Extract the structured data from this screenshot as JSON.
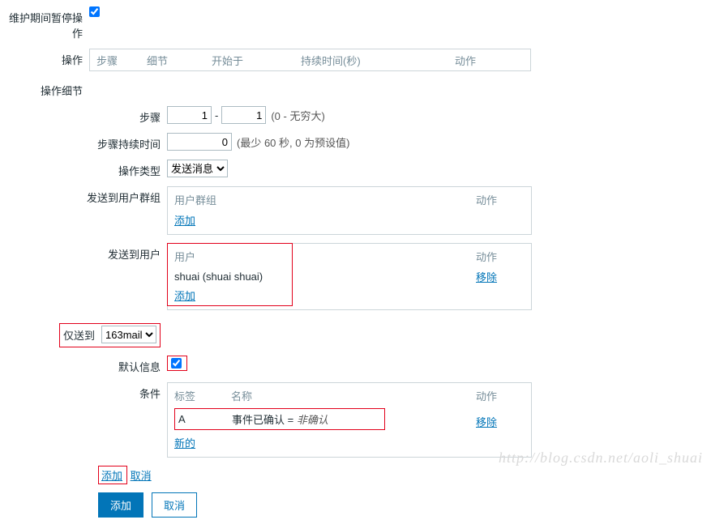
{
  "pause": {
    "label": "维护期间暂停操作",
    "checked": true
  },
  "ops": {
    "label": "操作",
    "tabs": {
      "steps": "步骤",
      "details": "细节",
      "start": "开始于",
      "duration": "持续时间(秒)",
      "action": "动作"
    }
  },
  "details_label": "操作细节",
  "steps": {
    "label": "步骤",
    "from": "1",
    "to": "1",
    "hint": "(0 - 无穷大)"
  },
  "step_duration": {
    "label": "步骤持续时间",
    "value": "0",
    "hint": "(最少 60 秒, 0 为预设值)"
  },
  "op_type": {
    "label": "操作类型",
    "selected": "发送消息"
  },
  "send_group": {
    "label": "发送到用户群组",
    "col_left": "用户群组",
    "col_right": "动作",
    "add": "添加"
  },
  "send_user": {
    "label": "发送到用户",
    "col_left": "用户",
    "col_right": "动作",
    "user": "shuai (shuai shuai)",
    "remove": "移除",
    "add": "添加"
  },
  "only_to": {
    "label": "仅送到",
    "selected": "163mail"
  },
  "default_msg": {
    "label": "默认信息",
    "checked": true
  },
  "conditions": {
    "label": "条件",
    "col_tag": "标签",
    "col_name": "名称",
    "col_action": "动作",
    "row": {
      "tag": "A",
      "name_prefix": "事件已确认 = ",
      "name_ital": "非确认"
    },
    "remove": "移除",
    "new": "新的"
  },
  "links": {
    "add": "添加",
    "cancel": "取消"
  },
  "buttons": {
    "add": "添加",
    "cancel": "取消"
  },
  "watermark": "http://blog.csdn.net/aoli_shuai"
}
